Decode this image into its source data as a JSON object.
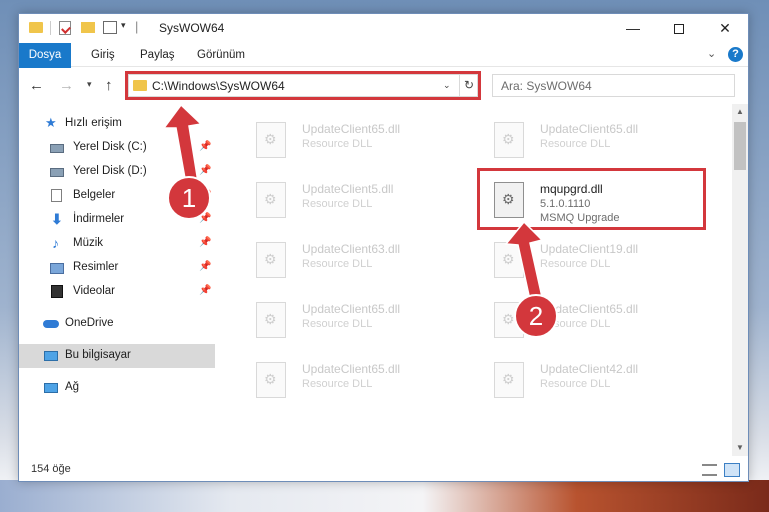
{
  "window": {
    "title": "SysWOW64",
    "minimize_label": "—",
    "close_label": "✕"
  },
  "ribbon": {
    "tabs": [
      {
        "label": "Dosya"
      },
      {
        "label": "Giriş"
      },
      {
        "label": "Paylaş"
      },
      {
        "label": "Görünüm"
      }
    ],
    "expand_icon": "⌄",
    "help_label": "?"
  },
  "nav": {
    "back_icon": "←",
    "forward_icon": "→",
    "recent_icon": "▾",
    "up_icon": "↑",
    "address": "C:\\Windows\\SysWOW64",
    "dropdown_icon": "⌄",
    "refresh_icon": "↻",
    "search_placeholder": "Ara: SysWOW64"
  },
  "sidebar": {
    "items": [
      {
        "label": "Hızlı erişim",
        "icon": "★"
      },
      {
        "label": "Yerel Disk (C:)"
      },
      {
        "label": "Yerel Disk (D:)"
      },
      {
        "label": "Belgeler"
      },
      {
        "label": "İndirmeler",
        "icon": "⬇"
      },
      {
        "label": "Müzik",
        "icon": "♪"
      },
      {
        "label": "Resimler"
      },
      {
        "label": "Videolar"
      },
      {
        "label": "OneDrive"
      },
      {
        "label": "Bu bilgisayar"
      },
      {
        "label": "Ağ"
      }
    ],
    "pin_icon": "📌"
  },
  "files": [
    {
      "name": "UpdateClient65.dll",
      "desc": "Resource DLL"
    },
    {
      "name": "UpdateClient65.dll",
      "desc": "Resource DLL"
    },
    {
      "name": "UpdateClient5.dll",
      "desc": "Resource DLL"
    },
    {
      "name": "mqupgrd.dll",
      "desc": "5.1.0.1110",
      "desc2": "MSMQ Upgrade"
    },
    {
      "name": "UpdateClient63.dll",
      "desc": "Resource DLL"
    },
    {
      "name": "UpdateClient19.dll",
      "desc": "Resource DLL"
    },
    {
      "name": "UpdateClient65.dll",
      "desc": "Resource DLL"
    },
    {
      "name": "UpdateClient65.dll",
      "desc": "Resource DLL"
    },
    {
      "name": "UpdateClient65.dll",
      "desc": "Resource DLL"
    },
    {
      "name": "UpdateClient42.dll",
      "desc": "Resource DLL"
    }
  ],
  "status": {
    "item_count": "154 öğe"
  },
  "callouts": {
    "one": "1",
    "two": "2"
  },
  "scroll": {
    "up_icon": "▲",
    "down_icon": "▼"
  },
  "colors": {
    "accent": "#1979ca",
    "highlight_red": "#d3373c"
  }
}
